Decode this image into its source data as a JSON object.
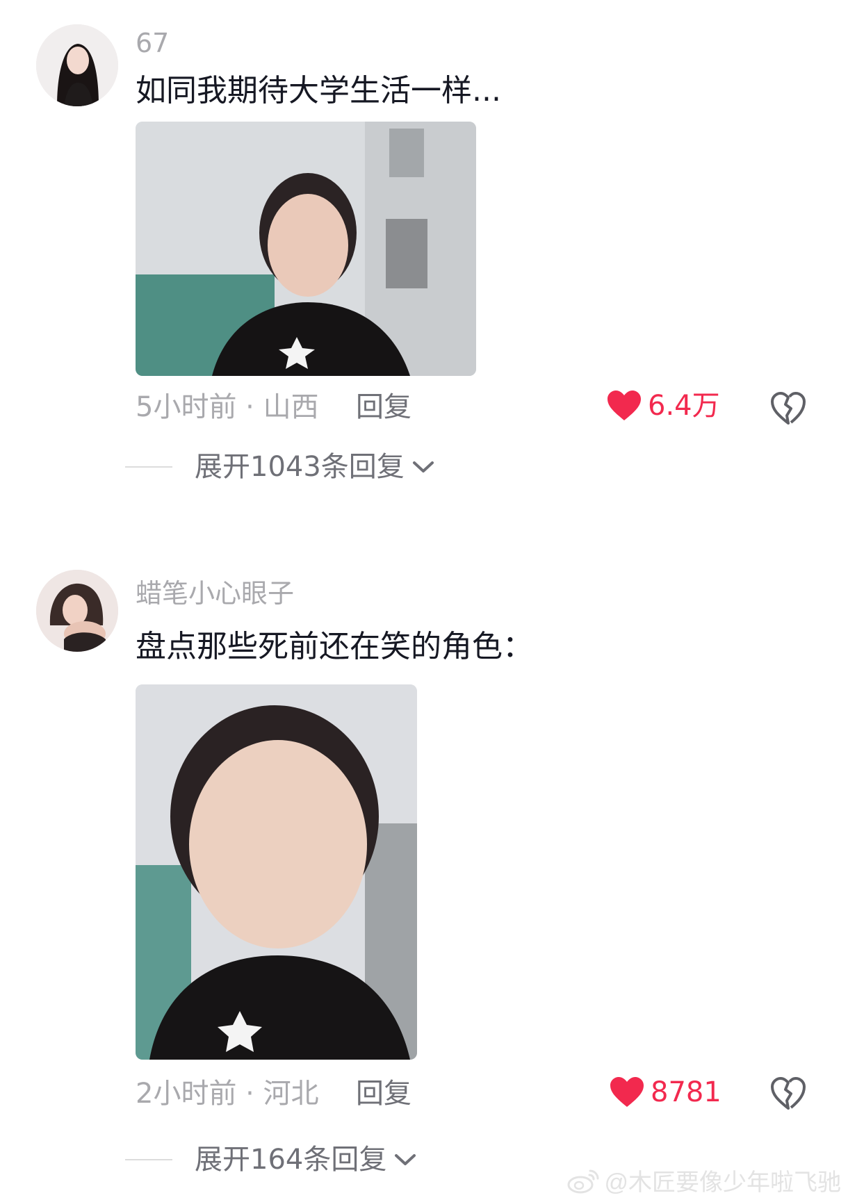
{
  "comments": [
    {
      "username": "67",
      "text": "如同我期待大学生活一样...",
      "time_location": "5小时前 · 山西",
      "reply_label": "回复",
      "likes": "6.4万",
      "expand_label": "展开1043条回复"
    },
    {
      "username": "蜡笔小心眼子",
      "text": "盘点那些死前还在笑的角色：",
      "time_location": "2小时前 · 河北",
      "reply_label": "回复",
      "likes": "8781",
      "expand_label": "展开164条回复"
    }
  ],
  "watermark": "@木匠要像少年啦飞驰",
  "colors": {
    "like_red": "#f2294e",
    "username_gray": "#a9a9ad",
    "text_dark": "#161823"
  },
  "icons": [
    "heart-icon",
    "broken-heart-icon",
    "chevron-down-icon",
    "weibo-logo-icon"
  ]
}
